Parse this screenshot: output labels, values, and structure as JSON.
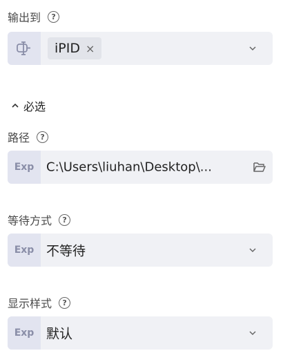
{
  "output": {
    "label": "输出到",
    "tag": "iPID",
    "tag_close": "×"
  },
  "section": {
    "title": "必选"
  },
  "path": {
    "label": "路径",
    "prefix": "Exp",
    "value": "C:\\Users\\liuhan\\Desktop\\..."
  },
  "wait": {
    "label": "等待方式",
    "prefix": "Exp",
    "value": "不等待"
  },
  "display": {
    "label": "显示样式",
    "prefix": "Exp",
    "value": "默认"
  },
  "help_symbol": "?",
  "colors": {
    "field_bg": "#f0f1f5",
    "prefix_bg": "#e2e4f0",
    "prefix_text": "#8a8ea8"
  }
}
